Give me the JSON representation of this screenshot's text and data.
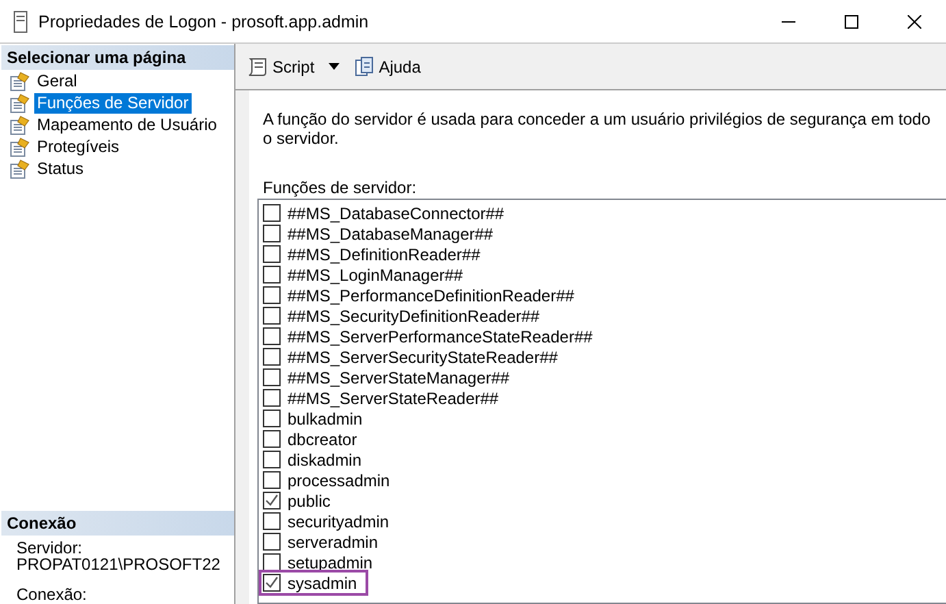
{
  "window": {
    "title": "Propriedades de Logon - prosoft.app.admin"
  },
  "sidebar": {
    "header": "Selecionar uma página",
    "items": [
      {
        "label": "Geral",
        "selected": false
      },
      {
        "label": "Funções de Servidor",
        "selected": true
      },
      {
        "label": "Mapeamento de Usuário",
        "selected": false
      },
      {
        "label": "Protegíveis",
        "selected": false
      },
      {
        "label": "Status",
        "selected": false
      }
    ]
  },
  "connection": {
    "header": "Conexão",
    "fields": [
      {
        "label": "Servidor:",
        "value": "PROPAT0121\\PROSOFT22"
      },
      {
        "label": "Conexão:"
      }
    ]
  },
  "toolbar": {
    "script": "Script",
    "help": "Ajuda"
  },
  "description": "A função do servidor é usada para conceder a um usuário privilégios de segurança em todo o servidor.",
  "roles_label": "Funções de servidor:",
  "roles": [
    {
      "name": "##MS_DatabaseConnector##",
      "checked": false,
      "highlighted": false
    },
    {
      "name": "##MS_DatabaseManager##",
      "checked": false,
      "highlighted": false
    },
    {
      "name": "##MS_DefinitionReader##",
      "checked": false,
      "highlighted": false
    },
    {
      "name": "##MS_LoginManager##",
      "checked": false,
      "highlighted": false
    },
    {
      "name": "##MS_PerformanceDefinitionReader##",
      "checked": false,
      "highlighted": false
    },
    {
      "name": "##MS_SecurityDefinitionReader##",
      "checked": false,
      "highlighted": false
    },
    {
      "name": "##MS_ServerPerformanceStateReader##",
      "checked": false,
      "highlighted": false
    },
    {
      "name": "##MS_ServerSecurityStateReader##",
      "checked": false,
      "highlighted": false
    },
    {
      "name": "##MS_ServerStateManager##",
      "checked": false,
      "highlighted": false
    },
    {
      "name": "##MS_ServerStateReader##",
      "checked": false,
      "highlighted": false
    },
    {
      "name": "bulkadmin",
      "checked": false,
      "highlighted": false
    },
    {
      "name": "dbcreator",
      "checked": false,
      "highlighted": false
    },
    {
      "name": "diskadmin",
      "checked": false,
      "highlighted": false
    },
    {
      "name": "processadmin",
      "checked": false,
      "highlighted": false
    },
    {
      "name": "public",
      "checked": true,
      "highlighted": false
    },
    {
      "name": "securityadmin",
      "checked": false,
      "highlighted": false
    },
    {
      "name": "serveradmin",
      "checked": false,
      "highlighted": false
    },
    {
      "name": "setupadmin",
      "checked": false,
      "highlighted": false
    },
    {
      "name": "sysadmin",
      "checked": true,
      "highlighted": true
    }
  ]
}
